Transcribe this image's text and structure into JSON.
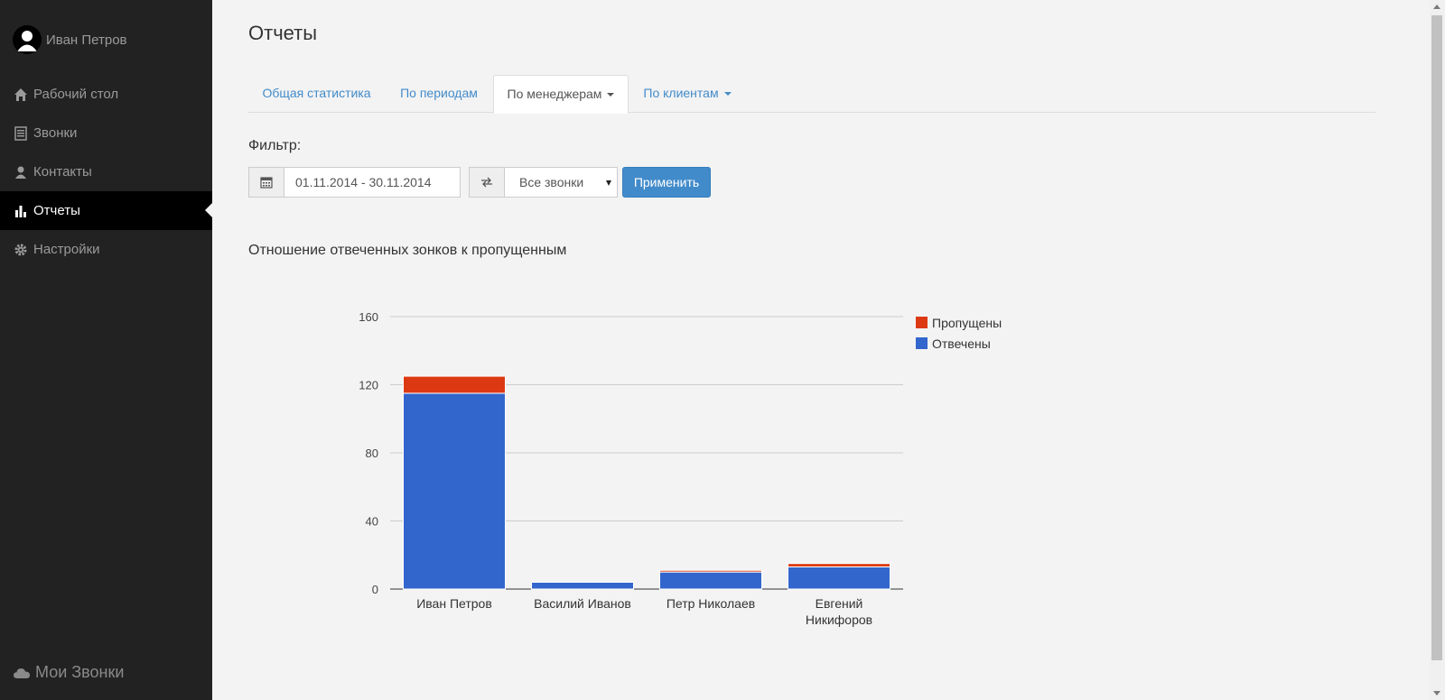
{
  "sidebar": {
    "user_name": "Иван Петров",
    "items": [
      {
        "label": "Рабочий стол",
        "icon": "home-icon"
      },
      {
        "label": "Звонки",
        "icon": "list-icon"
      },
      {
        "label": "Контакты",
        "icon": "user-icon"
      },
      {
        "label": "Отчеты",
        "icon": "bar-chart-icon",
        "active": true
      },
      {
        "label": "Настройки",
        "icon": "gear-icon"
      }
    ],
    "brand": "Мои Звонки"
  },
  "page": {
    "title": "Отчеты"
  },
  "tabs": [
    {
      "label": "Общая статистика"
    },
    {
      "label": "По периодам"
    },
    {
      "label": "По менеджерам",
      "active": true,
      "dropdown": true
    },
    {
      "label": "По клиентам",
      "dropdown": true
    }
  ],
  "filter": {
    "label": "Фильтр:",
    "date_range": "01.11.2014 - 30.11.2014",
    "call_type": "Все звонки",
    "apply_label": "Применить"
  },
  "colors": {
    "accent": "#428bca",
    "answered": "#3366cc",
    "missed": "#dc3912",
    "sidebar": "#222222"
  },
  "chart_data": {
    "type": "bar",
    "stacked": true,
    "title": "Отношение отвеченных зонков к пропущенным",
    "categories": [
      "Иван Петров",
      "Василий Иванов",
      "Петр Николаев",
      "Евгений Никифоров"
    ],
    "series": [
      {
        "name": "Отвечены",
        "color": "#3366cc",
        "values": [
          115,
          4,
          10,
          13
        ]
      },
      {
        "name": "Пропущены",
        "color": "#dc3912",
        "values": [
          10,
          0,
          1,
          2
        ]
      }
    ],
    "y_ticks": [
      "0",
      "40",
      "80",
      "120",
      "160"
    ],
    "ylim": [
      0,
      160
    ],
    "grid": true,
    "legend_position": "right"
  }
}
